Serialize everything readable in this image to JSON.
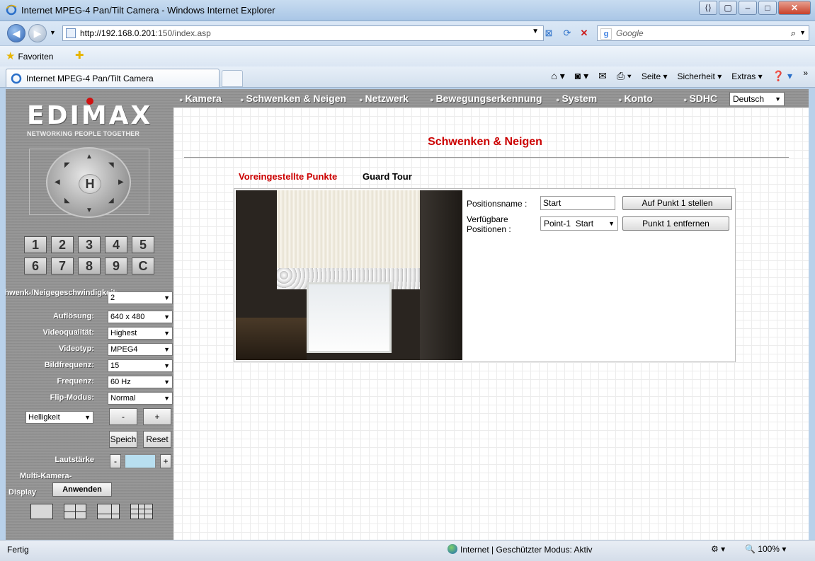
{
  "window": {
    "title": "Internet MPEG-4 Pan/Tilt Camera - Windows Internet Explorer"
  },
  "browser": {
    "url_host": "http://192.168.0.201",
    "url_rest": ":150/index.asp",
    "search_placeholder": "Google",
    "favorites_label": "Favoriten",
    "tab_title": "Internet MPEG-4 Pan/Tilt Camera",
    "cmd": {
      "page": "Seite",
      "security": "Sicherheit",
      "extras": "Extras"
    }
  },
  "brand": {
    "name": "EDIMAX",
    "tagline": "NETWORKING PEOPLE TOGETHER"
  },
  "ptz": {
    "home": "H"
  },
  "presets": [
    "1",
    "2",
    "3",
    "4",
    "5",
    "6",
    "7",
    "8",
    "9",
    "C"
  ],
  "controls": [
    {
      "label": "Schwenk-/Neigegeschwindigkeit:",
      "value": "2"
    },
    {
      "label": "Auflösung:",
      "value": "640 x 480"
    },
    {
      "label": "Videoqualität:",
      "value": "Highest"
    },
    {
      "label": "Videotyp:",
      "value": "MPEG4"
    },
    {
      "label": "Bildfrequenz:",
      "value": "15"
    },
    {
      "label": "Frequenz:",
      "value": "60 Hz"
    },
    {
      "label": "Flip-Modus:",
      "value": "Normal"
    }
  ],
  "adjust": {
    "mode": "Helligkeit",
    "minus": "-",
    "plus": "+",
    "save": "Speich",
    "reset": "Reset"
  },
  "volume": {
    "label": "Lautstärke",
    "minus": "-",
    "plus": "+"
  },
  "multicam": {
    "label_line1": "Multi-Kamera-",
    "label_line2": "Display",
    "apply": "Anwenden"
  },
  "menu": [
    "Kamera",
    "Schwenken & Neigen",
    "Netzwerk",
    "Bewegungserkennung",
    "System",
    "Konto",
    "SDHC"
  ],
  "language": "Deutsch",
  "content": {
    "title": "Schwenken & Neigen",
    "tab_active": "Voreingestellte Punkte",
    "tab_other": "Guard Tour",
    "position_name_label": "Positionsname :",
    "position_name_value": "Start",
    "goto_button": "Auf Punkt 1 stellen",
    "available_label_line1": "Verfügbare",
    "available_label_line2": "Positionen :",
    "available_value": "Point-1  Start",
    "remove_button": "Punkt 1 entfernen"
  },
  "status": {
    "text": "Fertig",
    "zone": "Internet | Geschützter Modus: Aktiv",
    "zoom": "100%"
  },
  "colors": {
    "accent": "#cc0000",
    "sidebar": "#8e8e8e"
  }
}
